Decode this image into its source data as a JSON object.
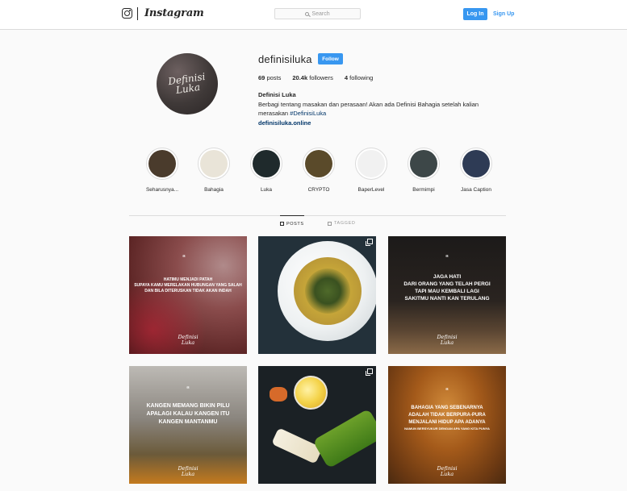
{
  "nav": {
    "wordmark": "Instagram",
    "search_placeholder": "Search",
    "login_label": "Log In",
    "signup_label": "Sign Up"
  },
  "profile": {
    "username": "definisiluka",
    "follow_label": "Follow",
    "posts_count": "69",
    "posts_label": "posts",
    "followers_count": "20.4k",
    "followers_label": "followers",
    "following_count": "4",
    "following_label": "following",
    "full_name": "Definisi Luka",
    "bio_line1": "Berbagi tentang masakan dan perasaan! Akan ada Definisi Bahagia setelah kalian",
    "bio_line2_prefix": "merasakan",
    "bio_hashtag": "#DefinisiLuka",
    "link": "definisiluka.online",
    "avatar_text_1": "Definisi",
    "avatar_text_2": "Luka"
  },
  "highlights": [
    {
      "label": "Seharusnya...",
      "color": "#4a3b2c"
    },
    {
      "label": "Bahagia",
      "color": "#e9e4d8"
    },
    {
      "label": "Luka",
      "color": "#1f2a2c"
    },
    {
      "label": "CRYPTO",
      "color": "#5a4a2a"
    },
    {
      "label": "BaperLevel",
      "color": "#f1f1f1"
    },
    {
      "label": "Bermimpi",
      "color": "#3d4748"
    },
    {
      "label": "Jasa Caption",
      "color": "#2e3b55"
    }
  ],
  "tabs": {
    "posts_label": "POSTS",
    "tagged_label": "TAGGED"
  },
  "posts": [
    {
      "quote": "“",
      "text_line1": "Hatimu menjadi patah",
      "text_line2": "supaya kamu merelakan hubungan yang salah",
      "text_line3": "dan bila diteruskan tidak akan indah",
      "sig1": "Definisi",
      "sig2": "Luka",
      "bg": "#7a3a36"
    },
    {
      "bg": "#27303a"
    },
    {
      "quote": "“",
      "text_line1": "Jaga hati",
      "text_line2": "dari orang yang telah pergi",
      "text_line3": "tapi mau kembali lagi",
      "text_line4": "sakitmu nanti kan terulang",
      "sig1": "Definisi",
      "sig2": "Luka",
      "bg": "#2a2421"
    },
    {
      "quote": "“",
      "text_line1": "Kangen memang bikin pilu",
      "text_line2": "apalagi kalau kangen itu",
      "text_line3": "kangen mantanmu",
      "sig1": "Definisi",
      "sig2": "Luka",
      "bg": "#6b6560"
    },
    {
      "bg": "#1c2226"
    },
    {
      "quote": "“",
      "text_line1": "Bahagia yang sebenarnya",
      "text_line2": "adalah tidak berpura-pura",
      "text_line3": "menjalani hidup apa adanya",
      "text_line4": "namun bersyukur dengan apa yang kita punya",
      "sig1": "Definisi",
      "sig2": "Luka",
      "bg": "#7a4a1e"
    }
  ]
}
